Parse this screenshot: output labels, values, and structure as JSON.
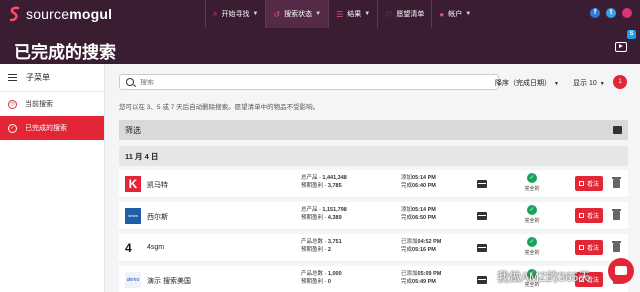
{
  "brand": {
    "name_light": "source",
    "name_bold": "mogul"
  },
  "nav": [
    {
      "label": "开始寻找",
      "icon": "search-icon",
      "active": false
    },
    {
      "label": "搜索状态",
      "icon": "history-icon",
      "active": true
    },
    {
      "label": "结果",
      "icon": "list-icon",
      "active": false
    },
    {
      "label": "愿望清单",
      "icon": "heart-icon",
      "active": false
    },
    {
      "label": "帐户",
      "icon": "user-icon",
      "active": false
    }
  ],
  "social": [
    "f",
    "t",
    "ig"
  ],
  "page_title": "已完成的搜索",
  "sidebar": {
    "header": "子菜单",
    "items": [
      {
        "label": "当前搜索",
        "active": false
      },
      {
        "label": "已完成的搜索",
        "active": true
      }
    ]
  },
  "search": {
    "placeholder": "搜索",
    "value": ""
  },
  "sort": {
    "label": "降序（完成日期）"
  },
  "show": {
    "label": "显示 10"
  },
  "badge_count": "1",
  "hint": "您可以在 3、5 或 7 天后自动删除搜索。愿望清单中的物品不受影响。",
  "filter_label": "筛选",
  "date_header": "11 月 4 日",
  "rows": [
    {
      "logo": "K",
      "name": "凯马特",
      "stat1_label": "总产品 - ",
      "stat1_value": "1,441,348",
      "stat2_label": "预期盈利 - ",
      "stat2_value": "3,785",
      "time1_label": "添加",
      "time1_value": "05:14 PM",
      "time2_label": "完成",
      "time2_value": "06:40 PM",
      "status": "完全的",
      "view": "看法"
    },
    {
      "logo": "sears",
      "name": "西尔斯",
      "stat1_label": "总产品 - ",
      "stat1_value": "1,151,798",
      "stat2_label": "预期盈利 - ",
      "stat2_value": "4,389",
      "time1_label": "添加",
      "time1_value": "05:14 PM",
      "time2_label": "完成",
      "time2_value": "06:50 PM",
      "status": "完全的",
      "view": "看法"
    },
    {
      "logo": "4",
      "name": "4sgm",
      "stat1_label": "产品总数 - ",
      "stat1_value": "3,751",
      "stat2_label": "预期盈利 - ",
      "stat2_value": "2",
      "time1_label": "已添加",
      "time1_value": "04:52 PM",
      "time2_label": "完成",
      "time2_value": "05:16 PM",
      "status": "完全的",
      "view": "看法"
    },
    {
      "logo": "demo",
      "name": "演示 搜索美国",
      "stat1_label": "产品总数 - ",
      "stat1_value": "1,000",
      "stat2_label": "预期盈利 - ",
      "stat2_value": "0",
      "time1_label": "已添加",
      "time1_value": "05:09 PM",
      "time2_label": "完成",
      "time2_value": "05:49 PM",
      "status": "完全的",
      "view": "看法"
    }
  ],
  "watermark": "我做AMZ的365天"
}
